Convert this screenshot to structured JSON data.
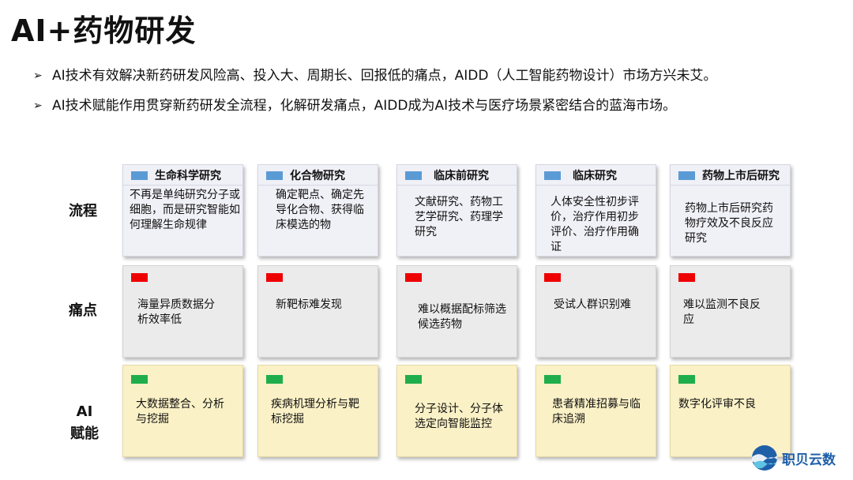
{
  "title": "AI+药物研发",
  "bullets": [
    "AI技术有效解决新药研发风险高、投入大、周期长、回报低的痛点，AIDD（人工智能药物设计）市场方兴未艾。",
    "AI技术赋能作用贯穿新药研发全流程，化解研发痛点，AIDD成为AI技术与医疗场景紧密结合的蓝海市场。"
  ],
  "row_labels": {
    "process": "流程",
    "pain": "痛点",
    "ai_line1": "AI",
    "ai_line2": "赋能"
  },
  "stages": [
    {
      "name": "生命科学研究",
      "process": "不再是单纯研究分子或细胞，而是研究智能如何理解生命规律",
      "pain": "海量异质数据分析效率低",
      "ai": "大数据整合、分析与挖掘"
    },
    {
      "name": "化合物研究",
      "process": "确定靶点、确定先导化合物、获得临床模选的物",
      "pain": "新靶标难发现",
      "ai": "疾病机理分析与靶标挖掘"
    },
    {
      "name": "临床前研究",
      "process": "文献研究、药物工艺学研究、药理学研究",
      "pain": "难以概据配标筛选候选药物",
      "ai": "分子设计、分子体选定向智能监控"
    },
    {
      "name": "临床研究",
      "process": "人体安全性初步评价，治疗作用初步评价、治疗作用确证",
      "pain": "受试人群识别难",
      "ai": "患者精准招募与临床追溯"
    },
    {
      "name": "药物上市后研究",
      "process": "药物上市后研究药物疗效及不良反应研究",
      "pain": "难以监测不良反应",
      "ai": "数字化评审不良"
    }
  ],
  "logo": {
    "text": "职贝云数"
  },
  "colors": {
    "process_marker": "#5b9bd5",
    "pain_marker": "#ee0000",
    "ai_marker": "#1fae4b",
    "process_bg": "#f0f0f7",
    "pain_bg": "#ebebeb",
    "ai_bg": "#fbf1c6",
    "logo_text": "#1f5fa8"
  }
}
